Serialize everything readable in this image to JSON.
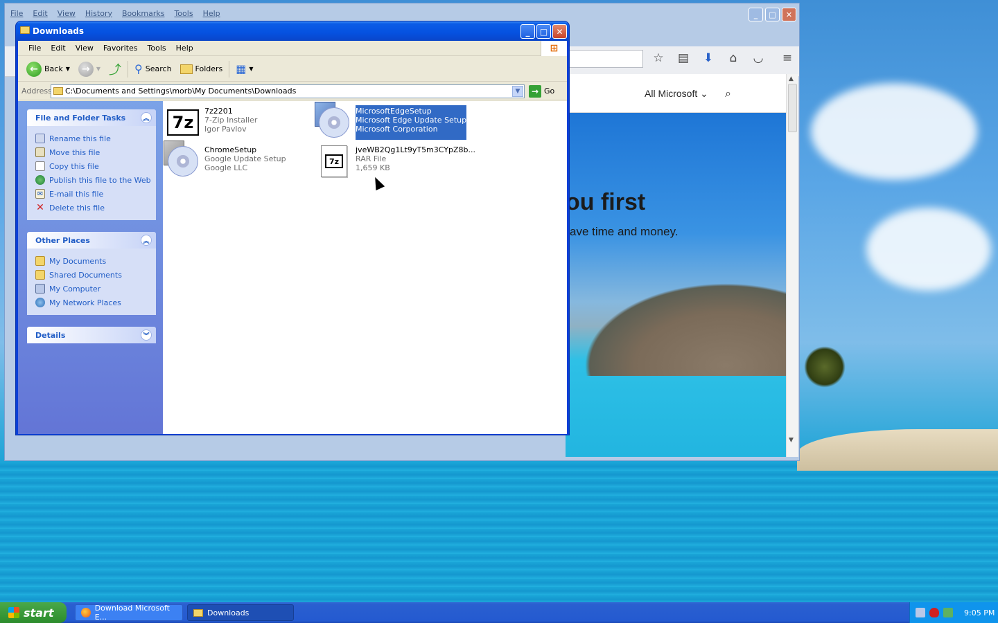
{
  "firefox": {
    "menu": [
      "File",
      "Edit",
      "View",
      "History",
      "Bookmarks",
      "Tools",
      "Help"
    ],
    "page": {
      "all_microsoft": "All Microsoft ⌄",
      "headline": "ou first",
      "subline": "ave time and money."
    }
  },
  "explorer": {
    "title": "Downloads",
    "menu": [
      "File",
      "Edit",
      "View",
      "Favorites",
      "Tools",
      "Help"
    ],
    "toolbar": {
      "back": "Back",
      "search": "Search",
      "folders": "Folders"
    },
    "address": {
      "label": "Address",
      "value": "C:\\Documents and Settings\\morb\\My Documents\\Downloads",
      "go": "Go"
    },
    "tasks": {
      "header": "File and Folder Tasks",
      "items": [
        "Rename this file",
        "Move this file",
        "Copy this file",
        "Publish this file to the Web",
        "E-mail this file",
        "Delete this file"
      ]
    },
    "places": {
      "header": "Other Places",
      "items": [
        "My Documents",
        "Shared Documents",
        "My Computer",
        "My Network Places"
      ]
    },
    "details": {
      "header": "Details"
    },
    "files": [
      {
        "name": "7z2201",
        "line1": "7-Zip Installer",
        "line2": "Igor Pavlov"
      },
      {
        "name": "MicrosoftEdgeSetup",
        "line1": "Microsoft Edge Update Setup",
        "line2": "Microsoft Corporation"
      },
      {
        "name": "ChromeSetup",
        "line1": "Google Update Setup",
        "line2": "Google LLC"
      },
      {
        "name": "jveWB2Qg1Lt9yT5m3CYpZ8b...",
        "line1": "RAR File",
        "line2": "1,659 KB"
      }
    ]
  },
  "taskbar": {
    "start": "start",
    "tasks": [
      "Download Microsoft E...",
      "Downloads"
    ],
    "clock": "9:05 PM"
  },
  "colors": {
    "xp_blue": "#0551e0",
    "selection": "#316ac5",
    "link_blue": "#215dc6"
  }
}
